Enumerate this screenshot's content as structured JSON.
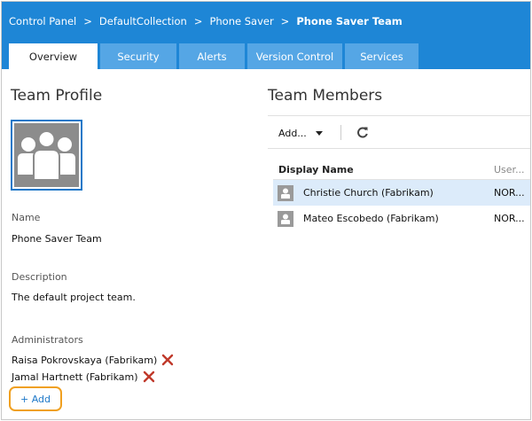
{
  "breadcrumb": {
    "items": [
      "Control Panel",
      "DefaultCollection",
      "Phone Saver",
      "Phone Saver Team"
    ],
    "separator": ">"
  },
  "tabs": [
    {
      "label": "Overview",
      "active": true
    },
    {
      "label": "Security",
      "active": false
    },
    {
      "label": "Alerts",
      "active": false
    },
    {
      "label": "Version Control",
      "active": false
    },
    {
      "label": "Services",
      "active": false
    }
  ],
  "profile": {
    "heading": "Team Profile",
    "avatar_icon": "team-group-icon",
    "name_label": "Name",
    "name_value": "Phone Saver Team",
    "description_label": "Description",
    "description_value": "The default project team.",
    "administrators_label": "Administrators",
    "administrators": [
      {
        "name": "Raisa Pokrovskaya (Fabrikam)",
        "remove_icon": "remove-x-icon"
      },
      {
        "name": "Jamal Hartnett (Fabrikam)",
        "remove_icon": "remove-x-icon"
      }
    ],
    "add_label": "+ Add"
  },
  "members": {
    "heading": "Team Members",
    "toolbar": {
      "add_label": "Add...",
      "refresh_icon": "refresh-icon"
    },
    "columns": [
      "Display Name",
      "User..."
    ],
    "rows": [
      {
        "display_name": "Christie Church (Fabrikam)",
        "user": "NOR...",
        "selected": true
      },
      {
        "display_name": "Mateo Escobedo (Fabrikam)",
        "user": "NOR...",
        "selected": false
      }
    ]
  },
  "colors": {
    "header_blue": "#1e86d6",
    "tab_inactive": "#55a6e5",
    "selected_row": "#dcebfa",
    "highlight_orange": "#f0a020",
    "remove_red": "#c0392b"
  }
}
